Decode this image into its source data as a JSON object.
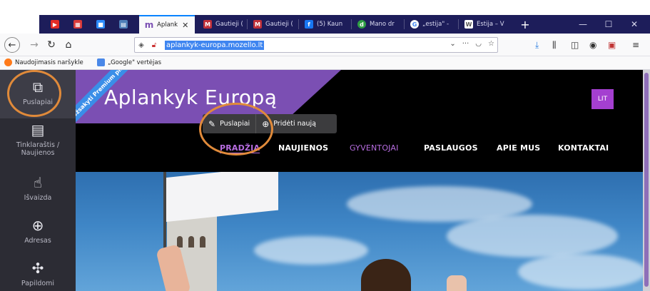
{
  "browser": {
    "tabs": [
      {
        "title": "",
        "favicon_color": "#e52d27",
        "icon": "youtube-icon",
        "pinned": true
      },
      {
        "title": "",
        "favicon_color": "#d93a3a",
        "icon": "calendar-icon",
        "pinned": true
      },
      {
        "title": "",
        "favicon_color": "#2d8cff",
        "icon": "zoom-icon",
        "pinned": true
      },
      {
        "title": "",
        "favicon_color": "#4f7fb8",
        "icon": "app-icon",
        "pinned": true
      },
      {
        "title": "Aplank",
        "favicon_color": "#7b4fb3",
        "icon": "mozello-icon",
        "active": true
      },
      {
        "title": "Gautieji (",
        "favicon_color": "#c0303a",
        "icon": "gmail-icon"
      },
      {
        "title": "Gautieji (",
        "favicon_color": "#c0303a",
        "icon": "gmail-icon"
      },
      {
        "title": "(5) Kaun",
        "favicon_color": "#1877f2",
        "icon": "facebook-icon"
      },
      {
        "title": "Mano dr",
        "favicon_color": "#2f9e44",
        "icon": "d-icon"
      },
      {
        "title": "„estija\" -",
        "favicon_color": "#4285f4",
        "icon": "google-icon"
      },
      {
        "title": "Estija – V",
        "favicon_color": "#555555",
        "icon": "wikipedia-icon"
      }
    ],
    "url": "aplankyk-europa.mozello.lt",
    "bookmarks": [
      {
        "label": "Naudojimasis naršykle",
        "icon": "firefox-icon"
      },
      {
        "label": "„Google\" vertėjas",
        "icon": "translate-icon"
      }
    ]
  },
  "editor_sidebar": {
    "items": [
      {
        "label": "Puslapiai",
        "icon": "pages-icon",
        "active": true
      },
      {
        "label": "Tinklaraštis / Naujienos",
        "icon": "blog-icon"
      },
      {
        "label": "Išvaizda",
        "icon": "appearance-icon"
      },
      {
        "label": "Adresas",
        "icon": "globe-icon"
      },
      {
        "label": "Papildomi",
        "icon": "puzzle-icon"
      }
    ]
  },
  "site": {
    "ribbon": "Užsakyti Premium planą",
    "logo": "Aplankyk Europą",
    "language_button": "LIT",
    "popover": {
      "pages_label": "Puslapiai",
      "add_label": "Pridėti naują"
    },
    "menu": [
      "PRADŽIA",
      "NAUJIENOS",
      "GYVENTOJAI",
      "PASLAUGOS",
      "APIE MUS",
      "KONTAKTAI"
    ]
  },
  "colors": {
    "accent_purple": "#7b4fb3",
    "menu_highlight": "#b76de0",
    "highlight_ring": "#e08a3a"
  }
}
